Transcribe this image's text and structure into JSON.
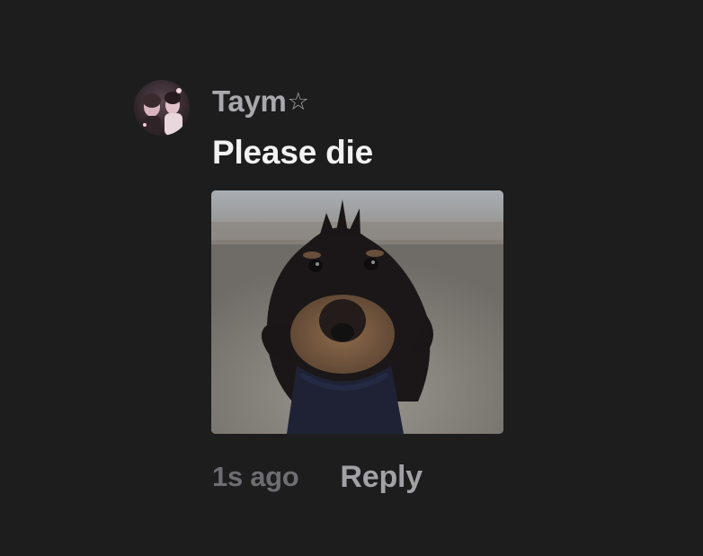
{
  "comment": {
    "username": "Taym",
    "badge_icon": "star-outline-icon",
    "badge_glyph": "☆",
    "text": "Please die",
    "attachment_icon": "dog-photo-icon",
    "timestamp": "1s ago",
    "reply_label": "Reply",
    "avatar_icon": "user-avatar-icon"
  },
  "colors": {
    "background": "#1d1d1e",
    "username": "#a9a9ad",
    "comment_text": "#f2f2f2",
    "timestamp": "#6e6e72",
    "reply": "#a2a2a6"
  }
}
